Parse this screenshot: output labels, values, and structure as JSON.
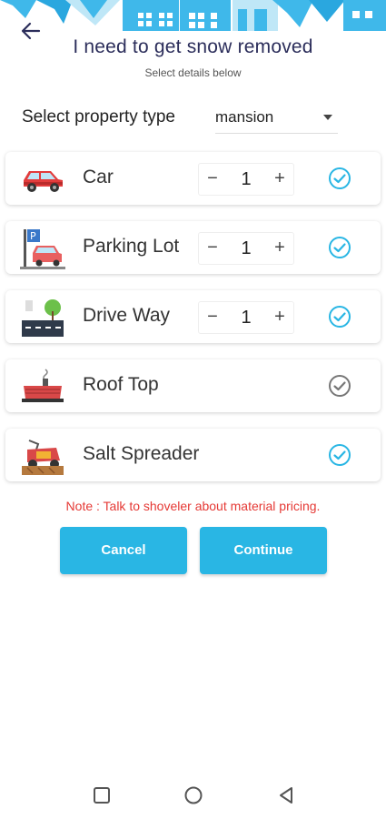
{
  "header": {
    "title": "I need to get snow removed",
    "subtitle": "Select details below",
    "back_icon": "arrow-left-icon"
  },
  "property_type": {
    "label": "Select property type",
    "value": "mansion"
  },
  "services": [
    {
      "label": "Car",
      "icon": "car-icon",
      "quantity": "1",
      "has_stepper": true,
      "selected": true
    },
    {
      "label": "Parking Lot",
      "icon": "parking-lot-icon",
      "quantity": "1",
      "has_stepper": true,
      "selected": true
    },
    {
      "label": "Drive Way",
      "icon": "driveway-icon",
      "quantity": "1",
      "has_stepper": true,
      "selected": true
    },
    {
      "label": "Roof Top",
      "icon": "roof-top-icon",
      "has_stepper": false,
      "selected": false
    },
    {
      "label": "Salt Spreader",
      "icon": "salt-spreader-icon",
      "has_stepper": false,
      "selected": true
    }
  ],
  "stepper": {
    "minus": "−",
    "plus": "+"
  },
  "note": "Note : Talk to shoveler about material pricing.",
  "actions": {
    "cancel": "Cancel",
    "continue": "Continue"
  },
  "colors": {
    "accent": "#29b6e4",
    "check_selected": "#29b6e4",
    "check_unselected": "#777777",
    "note": "#e53935",
    "title": "#2b2d5a"
  },
  "navbar": {
    "icons": [
      "recents-icon",
      "home-icon",
      "back-icon"
    ]
  }
}
